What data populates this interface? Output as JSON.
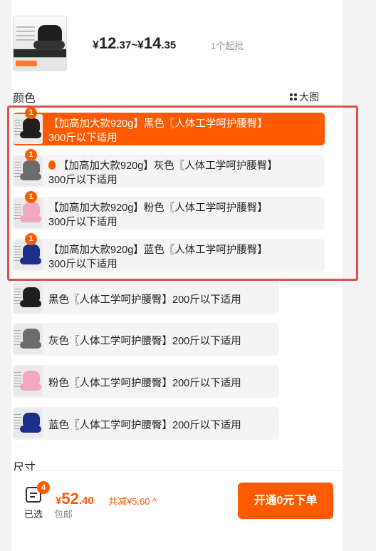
{
  "header": {
    "price_range": {
      "sym1": "¥",
      "min_int": "12",
      "min_dec": ".37",
      "sep": "~",
      "sym2": "¥",
      "max_int": "14",
      "max_dec": ".35"
    },
    "min_order": "1个起批"
  },
  "color_section": {
    "title": "颜色",
    "big_image_label": "大图",
    "options": [
      {
        "line1": "【加高加大款920g】黑色〖人体工学呵护腰臀】",
        "line2": "300斤以下适用",
        "count": "1",
        "selected": true,
        "color": "#1f1f1f",
        "hot": false
      },
      {
        "line1": "【加高加大款920g】灰色〖人体工学呵护腰臀】",
        "line2": "300斤以下适用",
        "count": "1",
        "selected": false,
        "color": "#6c6c6c",
        "hot": true
      },
      {
        "line1": "【加高加大款920g】粉色〖人体工学呵护腰臀】",
        "line2": "300斤以下适用",
        "count": "1",
        "selected": false,
        "color": "#f2a8c0",
        "hot": false
      },
      {
        "line1": "【加高加大款920g】蓝色〖人体工学呵护腰臀】",
        "line2": "300斤以下适用",
        "count": "1",
        "selected": false,
        "color": "#1d2e8a",
        "hot": false
      },
      {
        "line1": "黑色〖人体工学呵护腰臀】200斤以下适用",
        "selected": false,
        "color": "#1f1f1f"
      },
      {
        "line1": "灰色〖人体工学呵护腰臀】200斤以下适用",
        "selected": false,
        "color": "#6c6c6c"
      },
      {
        "line1": "粉色〖人体工学呵护腰臀】200斤以下适用",
        "selected": false,
        "color": "#f2a8c0"
      },
      {
        "line1": "蓝色〖人体工学呵护腰臀】200斤以下适用",
        "selected": false,
        "color": "#1d2e8a"
      }
    ]
  },
  "size_section": {
    "title": "尺寸"
  },
  "bottom_bar": {
    "cart_count": "4",
    "selected_label": "已选",
    "total": {
      "sym": "¥",
      "int": "52",
      "dec": ".40"
    },
    "discount": "共减¥5.60 ^",
    "shipping": "包邮",
    "order_button": "开通0元下单"
  },
  "colors": {
    "accent": "#ff5a00",
    "highlight_border": "#e0524c"
  }
}
